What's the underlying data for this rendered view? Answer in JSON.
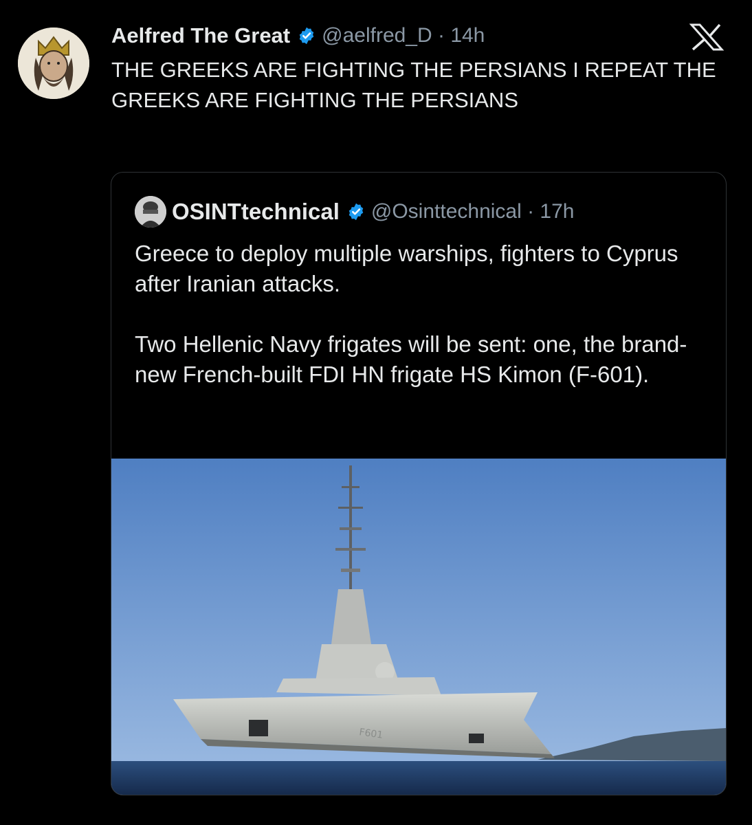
{
  "tweet": {
    "author_name": "Aelfred The Great",
    "handle_time": "@aelfred_D · 14h",
    "text": "THE GREEKS ARE FIGHTING THE PERSIANS I REPEAT THE GREEKS ARE FIGHTING THE PERSIANS",
    "avatar_icon": "king-portrait-avatar",
    "verified_color": "#1d9bf0"
  },
  "brand": {
    "logo_icon": "x-logo-icon"
  },
  "quoted_tweet": {
    "author_name": "OSINTtechnical",
    "handle_time": "@Osinttechnical · 17h",
    "paragraph_1": "Greece to deploy multiple warships, fighters to Cyprus after Iranian attacks.",
    "paragraph_2": "Two Hellenic Navy frigates will be sent: one, the brand-new French-built FDI HN frigate HS Kimon (F-601).",
    "media_icon": "frigate-photo"
  },
  "colors": {
    "background": "#000000",
    "text": "#e7e9ea",
    "secondary_text": "#8b98a5",
    "border": "#2f3336",
    "sky": "#5d87c4",
    "sea": "#1d3557"
  }
}
